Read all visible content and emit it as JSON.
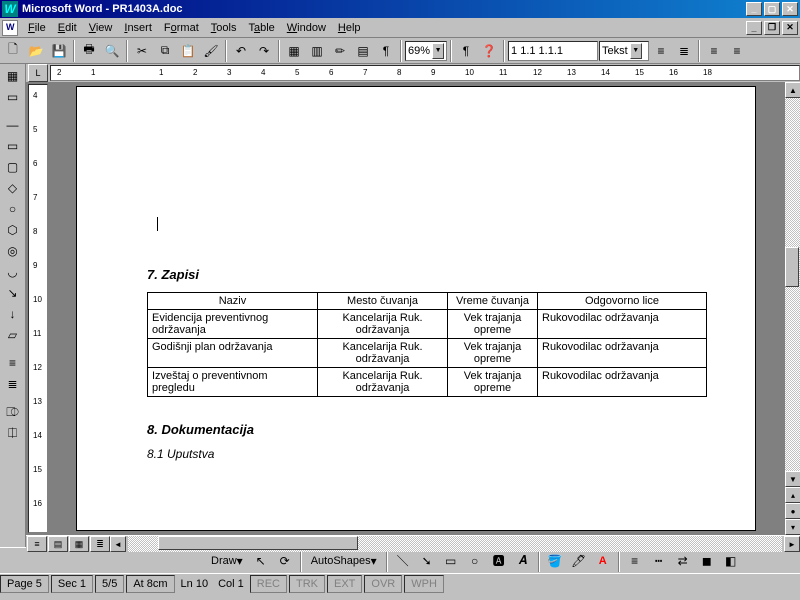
{
  "title": "Microsoft Word - PR1403A.doc",
  "menus": [
    "File",
    "Edit",
    "View",
    "Insert",
    "Format",
    "Tools",
    "Table",
    "Window",
    "Help"
  ],
  "zoom": "69%",
  "outline_style": "1 1.1 1.1.1",
  "style_label": "Tekst",
  "ruler_h": [
    "2",
    "1",
    "",
    "1",
    "2",
    "3",
    "4",
    "5",
    "6",
    "7",
    "8",
    "9",
    "10",
    "11",
    "12",
    "13",
    "14",
    "15",
    "16",
    "18"
  ],
  "ruler_v": [
    "4",
    "5",
    "6",
    "7",
    "8",
    "9",
    "10",
    "11",
    "12",
    "13",
    "14",
    "15",
    "16"
  ],
  "doc": {
    "section7": "7.  Zapisi",
    "section8": "8.  Dokumentacija",
    "sub81": "8.1   Uputstva",
    "table": {
      "headers": [
        "Naziv",
        "Mesto čuvanja",
        "Vreme čuvanja",
        "Odgovorno lice"
      ],
      "rows": [
        [
          "Evidencija preventivnog održavanja",
          "Kancelarija Ruk. održavanja",
          "Vek trajanja opreme",
          "Rukovodilac održavanja"
        ],
        [
          "Godišnji plan održavanja",
          "Kancelarija Ruk. održavanja",
          "Vek trajanja opreme",
          "Rukovodilac održavanja"
        ],
        [
          "Izveštaj o preventivnom pregledu",
          "Kancelarija Ruk. održavanja",
          "Vek trajanja opreme",
          "Rukovodilac održavanja"
        ]
      ]
    }
  },
  "drawbar": {
    "draw": "Draw",
    "autoshapes": "AutoShapes"
  },
  "status": {
    "page": "Page 5",
    "sec": "Sec 1",
    "pages": "5/5",
    "at": "At 8cm",
    "ln": "Ln 10",
    "col": "Col 1",
    "flags": [
      "REC",
      "TRK",
      "EXT",
      "OVR",
      "WPH"
    ]
  }
}
